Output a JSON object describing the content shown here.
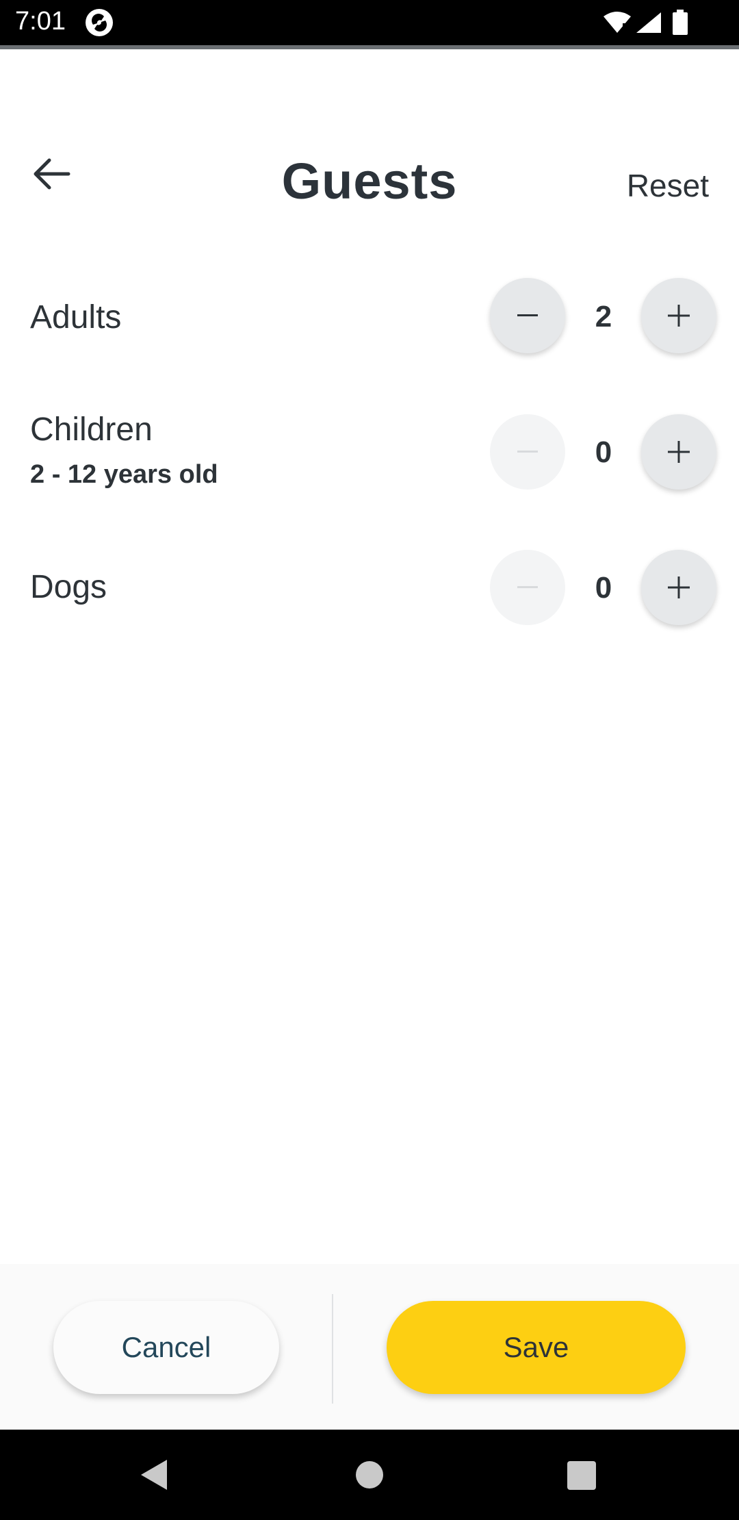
{
  "status_bar": {
    "time": "7:01"
  },
  "header": {
    "title": "Guests",
    "reset_label": "Reset"
  },
  "rows": [
    {
      "label": "Adults",
      "sublabel": "",
      "count": "2",
      "minus_enabled": true
    },
    {
      "label": "Children",
      "sublabel": "2 - 12 years old",
      "count": "0",
      "minus_enabled": false
    },
    {
      "label": "Dogs",
      "sublabel": "",
      "count": "0",
      "minus_enabled": false
    }
  ],
  "footer": {
    "cancel_label": "Cancel",
    "save_label": "Save"
  },
  "colors": {
    "accent": "#fdcf12",
    "text": "#2d3338",
    "cancel_text": "#23475a"
  },
  "icons": {
    "back": "arrow-left-icon",
    "minus": "minus-icon",
    "plus": "plus-icon",
    "wifi": "wifi-icon",
    "signal": "signal-icon",
    "battery": "battery-icon"
  }
}
